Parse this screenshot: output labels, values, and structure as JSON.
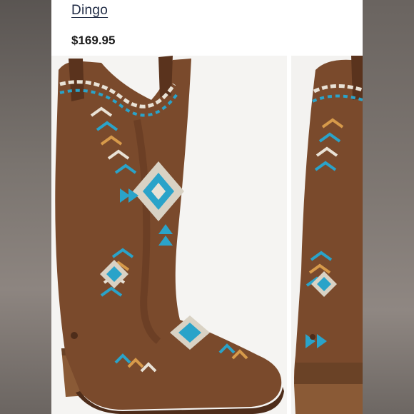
{
  "listing": {
    "brand": "Dingo",
    "price": "$169.95"
  },
  "gallery": {
    "images": [
      {
        "icon": "boot-photo-main"
      },
      {
        "icon": "boot-photo-side"
      }
    ]
  },
  "colors": {
    "leather": "#7a4a2c",
    "leather_dark": "#4e2d1a",
    "turquoise": "#2aa3c9",
    "tan": "#d79a4a",
    "cream": "#e9e2d6"
  }
}
